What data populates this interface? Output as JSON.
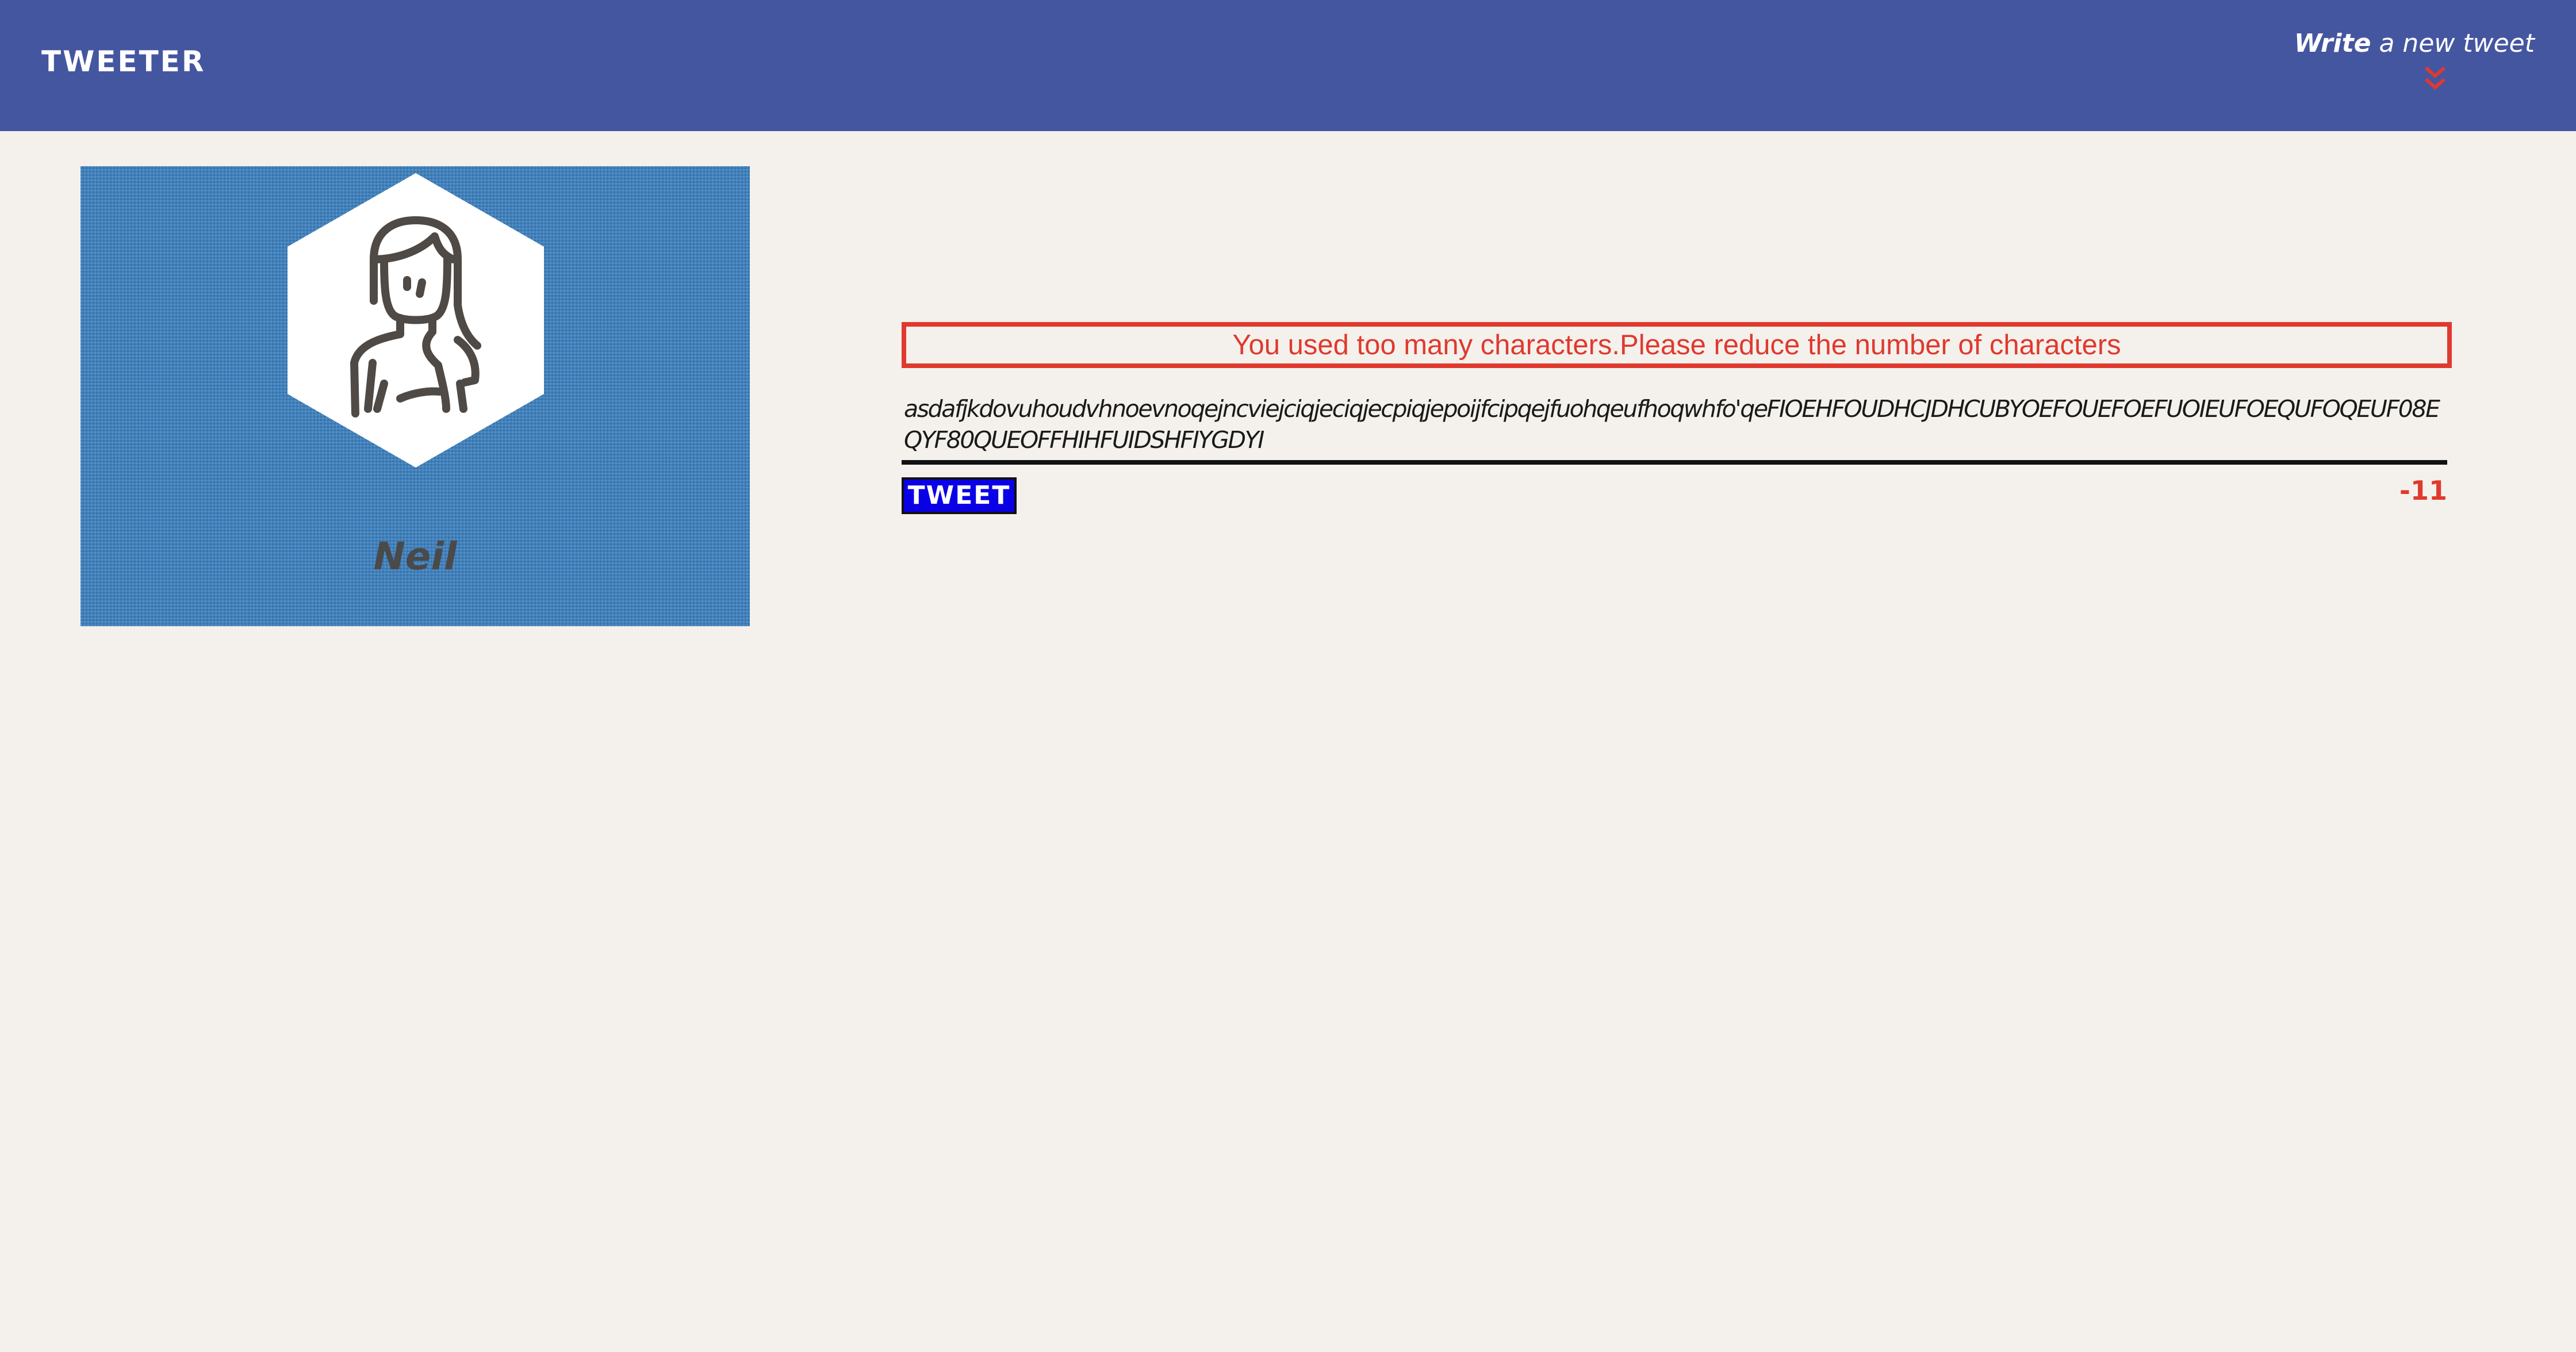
{
  "navbar": {
    "brand": "TWEETER",
    "compose": {
      "strong": "Write",
      "rest": " a new tweet",
      "icon": "chevron-double-down-icon"
    },
    "background": "#4556a0"
  },
  "profile": {
    "name": "Neil",
    "avatar_icon": "woman-avatar-icon",
    "card_color": "#3b80bf"
  },
  "compose_form": {
    "error_message": "You used too many characters.Please reduce the number of characters",
    "tweet_text": "asdafjkdovuhoudvhnoevnoqejncviejciqjeciqjecpiqjepoijfcipqejfuohqeufhoqwhfo'qeFIOEHFOUDHCJDHCUBYOEFOUEFOEFUOIEUFOEQUFOQEUF08EQYF80QUEOFFHIHFUIDSHFIYGDYI",
    "button_label": "TWEET",
    "char_counter": "-11",
    "accent_color": "#e0392e",
    "button_color": "#0a00e6"
  }
}
